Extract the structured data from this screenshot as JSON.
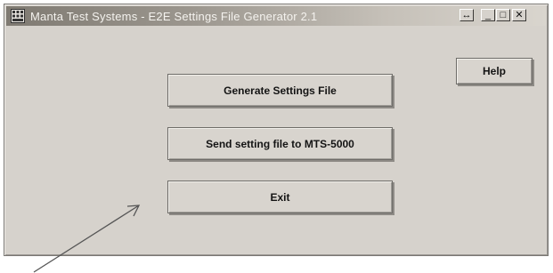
{
  "window": {
    "title": "Manta Test Systems - E2E Settings File Generator 2.1",
    "icon": "app-grid-icon"
  },
  "titlebar_buttons": {
    "restore_icon": "↔",
    "minimize_icon": "_",
    "maximize_icon": "□",
    "close_icon": "✕"
  },
  "buttons": {
    "generate_label": "Generate Settings File",
    "send_label": "Send setting file to MTS-5000",
    "exit_label": "Exit",
    "help_label": "Help"
  },
  "annotation": {
    "arrow_icon": "pointer-arrow",
    "color": "#555555"
  }
}
